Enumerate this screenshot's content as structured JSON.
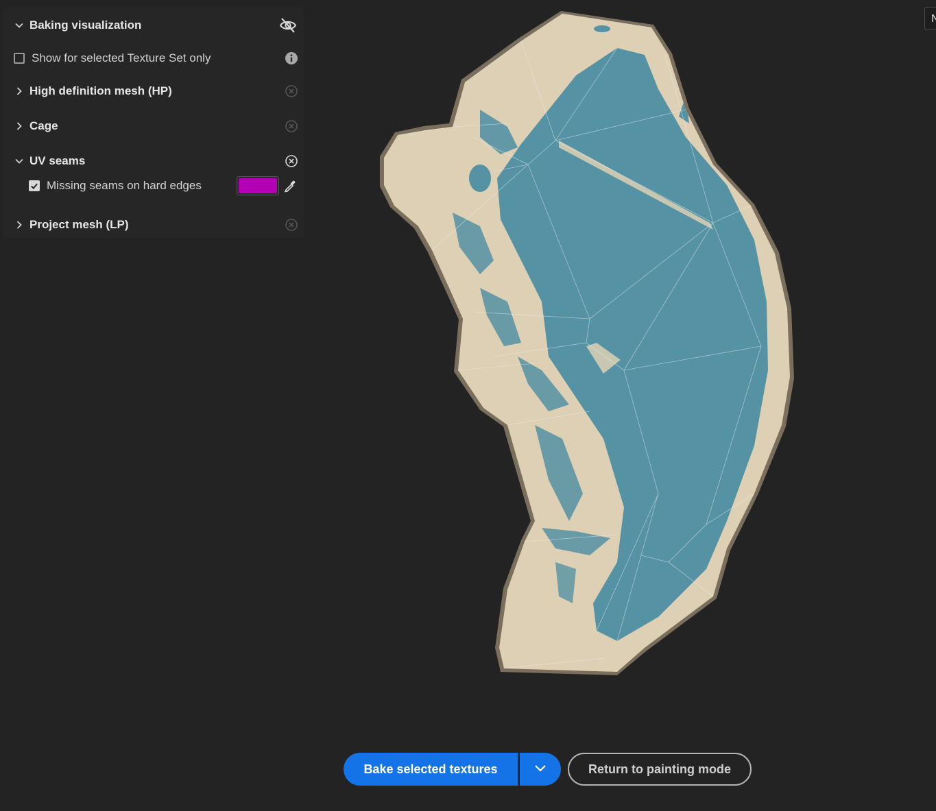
{
  "panel": {
    "baking_visualization": {
      "label": "Baking visualization",
      "expanded": true,
      "visibility_icon": "eye-off-icon",
      "show_selected_only": {
        "label": "Show for selected Texture Set only",
        "checked": false,
        "info_icon": "info-icon"
      }
    },
    "sections": {
      "hp": {
        "label": "High definition mesh (HP)",
        "expanded": false
      },
      "cage": {
        "label": "Cage",
        "expanded": false
      },
      "uv_seams": {
        "label": "UV seams",
        "expanded": true,
        "missing_seams": {
          "label": "Missing seams on hard edges",
          "checked": true,
          "color": "#b400b4",
          "picker_icon": "eyedropper-icon"
        }
      },
      "lp": {
        "label": "Project mesh (LP)",
        "expanded": false
      }
    }
  },
  "top_right_tab": {
    "label": "N"
  },
  "viewport": {
    "mesh_colors": {
      "outline": "#7a6e5c",
      "body": "#ddd0b4",
      "inner": "#5592a4"
    }
  },
  "actions": {
    "bake_label": "Bake selected textures",
    "bake_dropdown_icon": "chevron-down-icon",
    "return_label": "Return to painting mode"
  },
  "colors": {
    "accent": "#1473e6",
    "magenta": "#b400b4"
  }
}
